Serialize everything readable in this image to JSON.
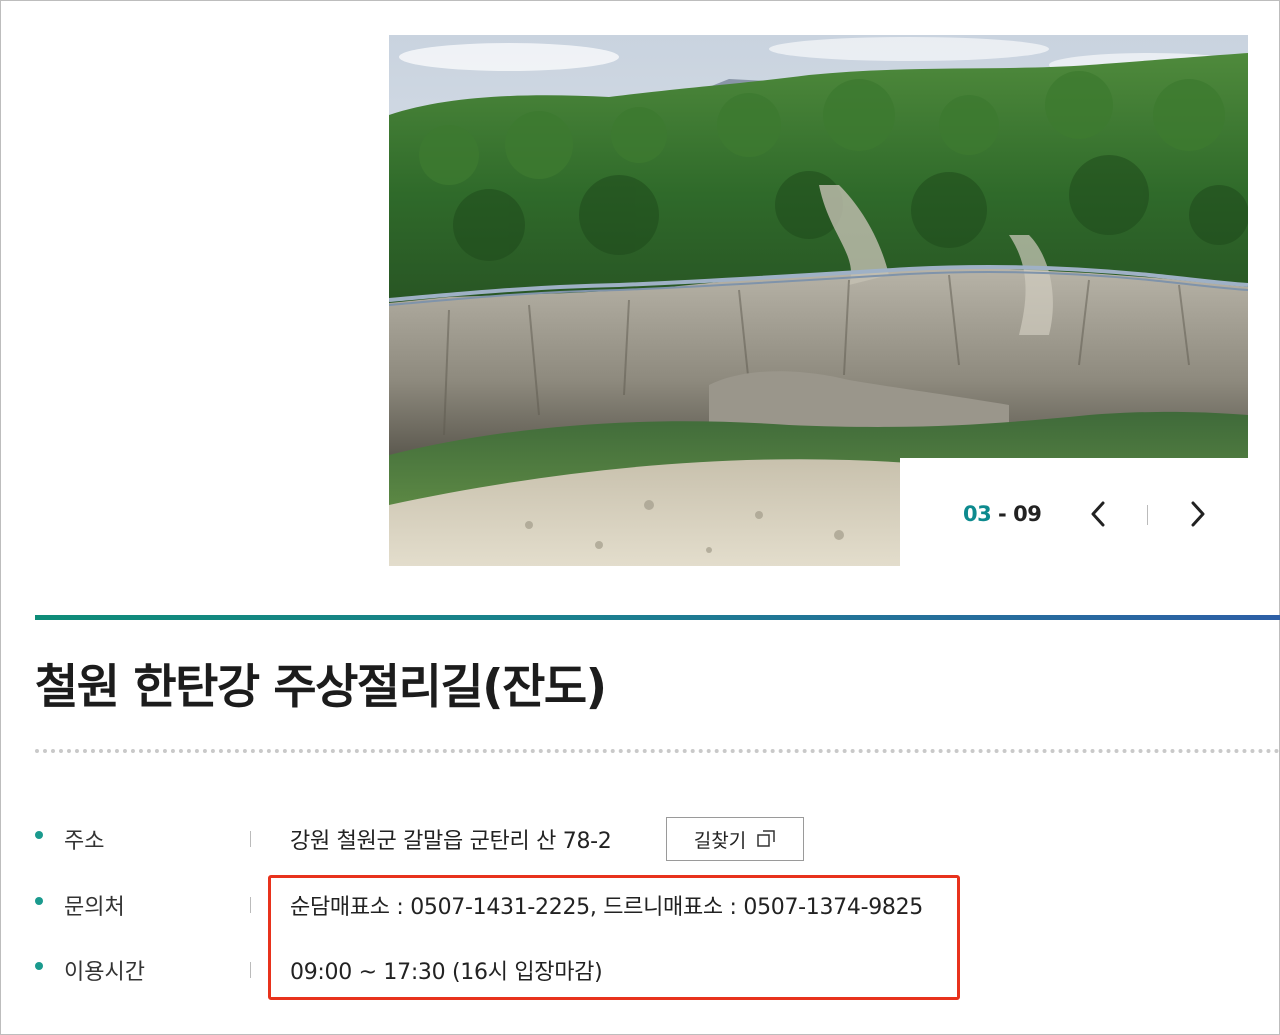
{
  "gallery": {
    "current": "03",
    "separator": "-",
    "total": "09",
    "prev_icon": "chevron-left-icon",
    "next_icon": "chevron-right-icon"
  },
  "title": "철원 한탄강 주상절리길(잔도)",
  "info": {
    "address": {
      "label": "주소",
      "value": "강원 철원군 갈말읍 군탄리 산 78-2",
      "button_label": "길찾기",
      "button_icon": "external-window-icon"
    },
    "contact": {
      "label": "문의처",
      "value": "순담매표소 : 0507-1431-2225, 드르니매표소 : 0507-1374-9825"
    },
    "hours": {
      "label": "이용시간",
      "value": "09:00 ~ 17:30 (16시 입장마감)"
    }
  },
  "colors": {
    "accent": "#0d8a8e",
    "bullet": "#1a9a8e",
    "highlight": "#e8321c",
    "bar_start": "#0e8c78",
    "bar_end": "#2d5fa6"
  }
}
